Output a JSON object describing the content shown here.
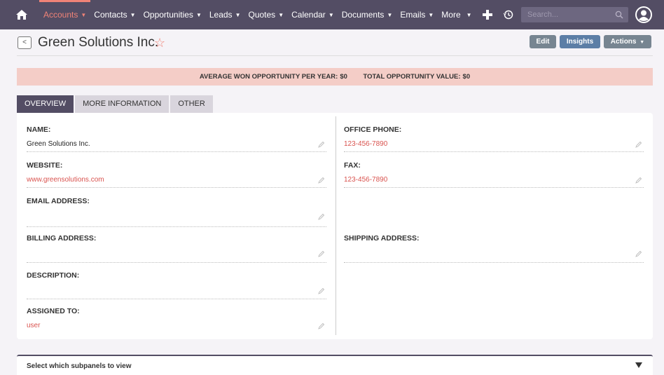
{
  "nav": {
    "items": [
      {
        "label": "Accounts",
        "active": true
      },
      {
        "label": "Contacts",
        "active": false
      },
      {
        "label": "Opportunities",
        "active": false
      },
      {
        "label": "Leads",
        "active": false
      },
      {
        "label": "Quotes",
        "active": false
      },
      {
        "label": "Calendar",
        "active": false
      },
      {
        "label": "Documents",
        "active": false
      },
      {
        "label": "Emails",
        "active": false
      },
      {
        "label": "More",
        "active": false
      }
    ],
    "search_placeholder": "Search...",
    "icons": [
      "home-icon",
      "plus-icon",
      "history-icon",
      "search-icon",
      "user-icon"
    ]
  },
  "header": {
    "title": "Green Solutions Inc.",
    "favorite_icon": "star-outline-icon",
    "back_label": "<",
    "buttons": {
      "edit": "Edit",
      "insights": "Insights",
      "actions": "Actions"
    }
  },
  "banner": {
    "avg_won_label": "AVERAGE WON OPPORTUNITY PER YEAR:",
    "avg_won_value": "$0",
    "total_label": "TOTAL OPPORTUNITY VALUE:",
    "total_value": "$0"
  },
  "tabs": [
    {
      "label": "OVERVIEW",
      "active": true
    },
    {
      "label": "MORE INFORMATION",
      "active": false
    },
    {
      "label": "OTHER",
      "active": false
    }
  ],
  "fields": {
    "name": {
      "label": "NAME:",
      "value": "Green Solutions Inc."
    },
    "website": {
      "label": "WEBSITE:",
      "value": "www.greensolutions.com"
    },
    "email": {
      "label": "EMAIL ADDRESS:",
      "value": ""
    },
    "billing": {
      "label": "BILLING ADDRESS:",
      "value": ""
    },
    "description": {
      "label": "DESCRIPTION:",
      "value": ""
    },
    "assigned": {
      "label": "ASSIGNED TO:",
      "value": "user"
    },
    "office_phone": {
      "label": "OFFICE PHONE:",
      "value": "123-456-7890"
    },
    "fax": {
      "label": "FAX:",
      "value": "123-456-7890"
    },
    "shipping": {
      "label": "SHIPPING ADDRESS:",
      "value": ""
    }
  },
  "subpanel": {
    "label": "Select which subpanels to view"
  },
  "colors": {
    "nav_bg": "#534d64",
    "accent": "#f08377",
    "link": "#d9534f",
    "banner_bg": "#f4cdc7",
    "insights_btn": "#5c7ea6",
    "secondary_btn": "#778591"
  }
}
